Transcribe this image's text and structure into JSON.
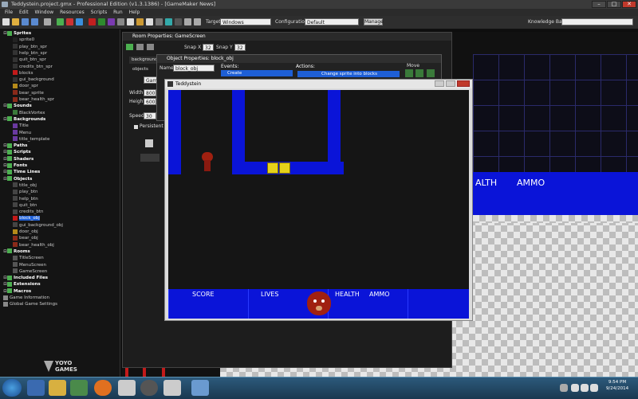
{
  "window": {
    "title": "Teddystein.project.gmx  -  Professional Edition (v1.3.1386)  -  [GameMaker News]",
    "min": "–",
    "max": "□",
    "close": "✕"
  },
  "menu": [
    "File",
    "Edit",
    "Window",
    "Resources",
    "Scripts",
    "Run",
    "Help"
  ],
  "toolbar": {
    "target_label": "Target",
    "target_value": "Windows",
    "config_label": "Configuration",
    "config_value": "Default",
    "manage_label": "Manage",
    "kb_label": "Knowledge Base"
  },
  "tree": [
    {
      "label": "Sprites",
      "kind": "folder",
      "depth": 0
    },
    {
      "label": "sprite0",
      "kind": "item",
      "depth": 1,
      "color": "#222"
    },
    {
      "label": "play_btn_spr",
      "kind": "item",
      "depth": 1,
      "color": "#333"
    },
    {
      "label": "help_btn_spr",
      "kind": "item",
      "depth": 1,
      "color": "#333"
    },
    {
      "label": "quit_btn_spr",
      "kind": "item",
      "depth": 1,
      "color": "#333"
    },
    {
      "label": "credits_btn_spr",
      "kind": "item",
      "depth": 1,
      "color": "#333"
    },
    {
      "label": "blocks",
      "kind": "item",
      "depth": 1,
      "color": "#c21a1a"
    },
    {
      "label": "gui_background",
      "kind": "item",
      "depth": 1,
      "color": "#333"
    },
    {
      "label": "door_spr",
      "kind": "item",
      "depth": 1,
      "color": "#b58a1a"
    },
    {
      "label": "bear_sprite",
      "kind": "item",
      "depth": 1,
      "color": "#8a2a1a"
    },
    {
      "label": "bear_health_spr",
      "kind": "item",
      "depth": 1,
      "color": "#8a2a1a"
    },
    {
      "label": "Sounds",
      "kind": "folder",
      "depth": 0
    },
    {
      "label": "BlackVortex",
      "kind": "item",
      "depth": 1,
      "color": "#3a7a3a"
    },
    {
      "label": "Backgrounds",
      "kind": "folder",
      "depth": 0
    },
    {
      "label": "Title",
      "kind": "item",
      "depth": 1,
      "color": "#6a3aa0"
    },
    {
      "label": "Menu",
      "kind": "item",
      "depth": 1,
      "color": "#6a3aa0"
    },
    {
      "label": "title_template",
      "kind": "item",
      "depth": 1,
      "color": "#6a3aa0"
    },
    {
      "label": "Paths",
      "kind": "folder",
      "depth": 0
    },
    {
      "label": "Scripts",
      "kind": "folder",
      "depth": 0
    },
    {
      "label": "Shaders",
      "kind": "folder",
      "depth": 0
    },
    {
      "label": "Fonts",
      "kind": "folder",
      "depth": 0
    },
    {
      "label": "Time Lines",
      "kind": "folder",
      "depth": 0
    },
    {
      "label": "Objects",
      "kind": "folder",
      "depth": 0
    },
    {
      "label": "title_obj",
      "kind": "item",
      "depth": 1,
      "color": "#444"
    },
    {
      "label": "play_btn",
      "kind": "item",
      "depth": 1,
      "color": "#444"
    },
    {
      "label": "help_btn",
      "kind": "item",
      "depth": 1,
      "color": "#444"
    },
    {
      "label": "quit_btn",
      "kind": "item",
      "depth": 1,
      "color": "#444"
    },
    {
      "label": "credits_btn",
      "kind": "item",
      "depth": 1,
      "color": "#444"
    },
    {
      "label": "block_obj",
      "kind": "item",
      "depth": 1,
      "color": "#c21a1a",
      "selected": true
    },
    {
      "label": "gui_background_obj",
      "kind": "item",
      "depth": 1,
      "color": "#444"
    },
    {
      "label": "door_obj",
      "kind": "item",
      "depth": 1,
      "color": "#b58a1a"
    },
    {
      "label": "bear_obj",
      "kind": "item",
      "depth": 1,
      "color": "#8a2a1a"
    },
    {
      "label": "bear_health_obj",
      "kind": "item",
      "depth": 1,
      "color": "#8a2a1a"
    },
    {
      "label": "Rooms",
      "kind": "folder",
      "depth": 0
    },
    {
      "label": "TitleScreen",
      "kind": "item",
      "depth": 1,
      "color": "#555"
    },
    {
      "label": "MenuScreen",
      "kind": "item",
      "depth": 1,
      "color": "#555"
    },
    {
      "label": "GameScreen",
      "kind": "item",
      "depth": 1,
      "color": "#555"
    },
    {
      "label": "Included Files",
      "kind": "folder",
      "depth": 0
    },
    {
      "label": "Extensions",
      "kind": "folder",
      "depth": 0
    },
    {
      "label": "Macros",
      "kind": "folder",
      "depth": 0
    },
    {
      "label": "Game Information",
      "kind": "item",
      "depth": 0,
      "color": "#888"
    },
    {
      "label": "Global Game Settings",
      "kind": "item",
      "depth": 0,
      "color": "#888"
    }
  ],
  "logo": {
    "line1": "YOYO",
    "line2": "GAMES"
  },
  "room_props": {
    "title": "Room Properties: GameScreen",
    "snapx_label": "Snap X",
    "snapx_value": "32",
    "snapy_label": "Snap Y",
    "snapy_value": "32",
    "tab_bg": "backgrounds",
    "tab_obj": "objects",
    "name_value": "Game",
    "width_label": "Width",
    "width_value": "800",
    "height_label": "Height",
    "height_value": "600",
    "speed_label": "Speed",
    "speed_value": "30",
    "persist_label": "Persistent"
  },
  "obj_props": {
    "title": "Object Properties: block_obj",
    "name_label": "Name",
    "name_value": "block_obj",
    "events_label": "Events:",
    "event_create": "Create",
    "actions_label": "Actions:",
    "action_1": "Change sprite into blocks",
    "move_label": "Move"
  },
  "game_window": {
    "title": "Teddystein",
    "hud": {
      "score": "SCORE",
      "lives": "LIVES",
      "health": "HEALTH",
      "ammo": "AMMO"
    }
  },
  "room_hud": {
    "health": "ALTH",
    "ammo": "AMMO"
  },
  "clock": {
    "time": "9:54 PM",
    "date": "9/24/2014"
  }
}
